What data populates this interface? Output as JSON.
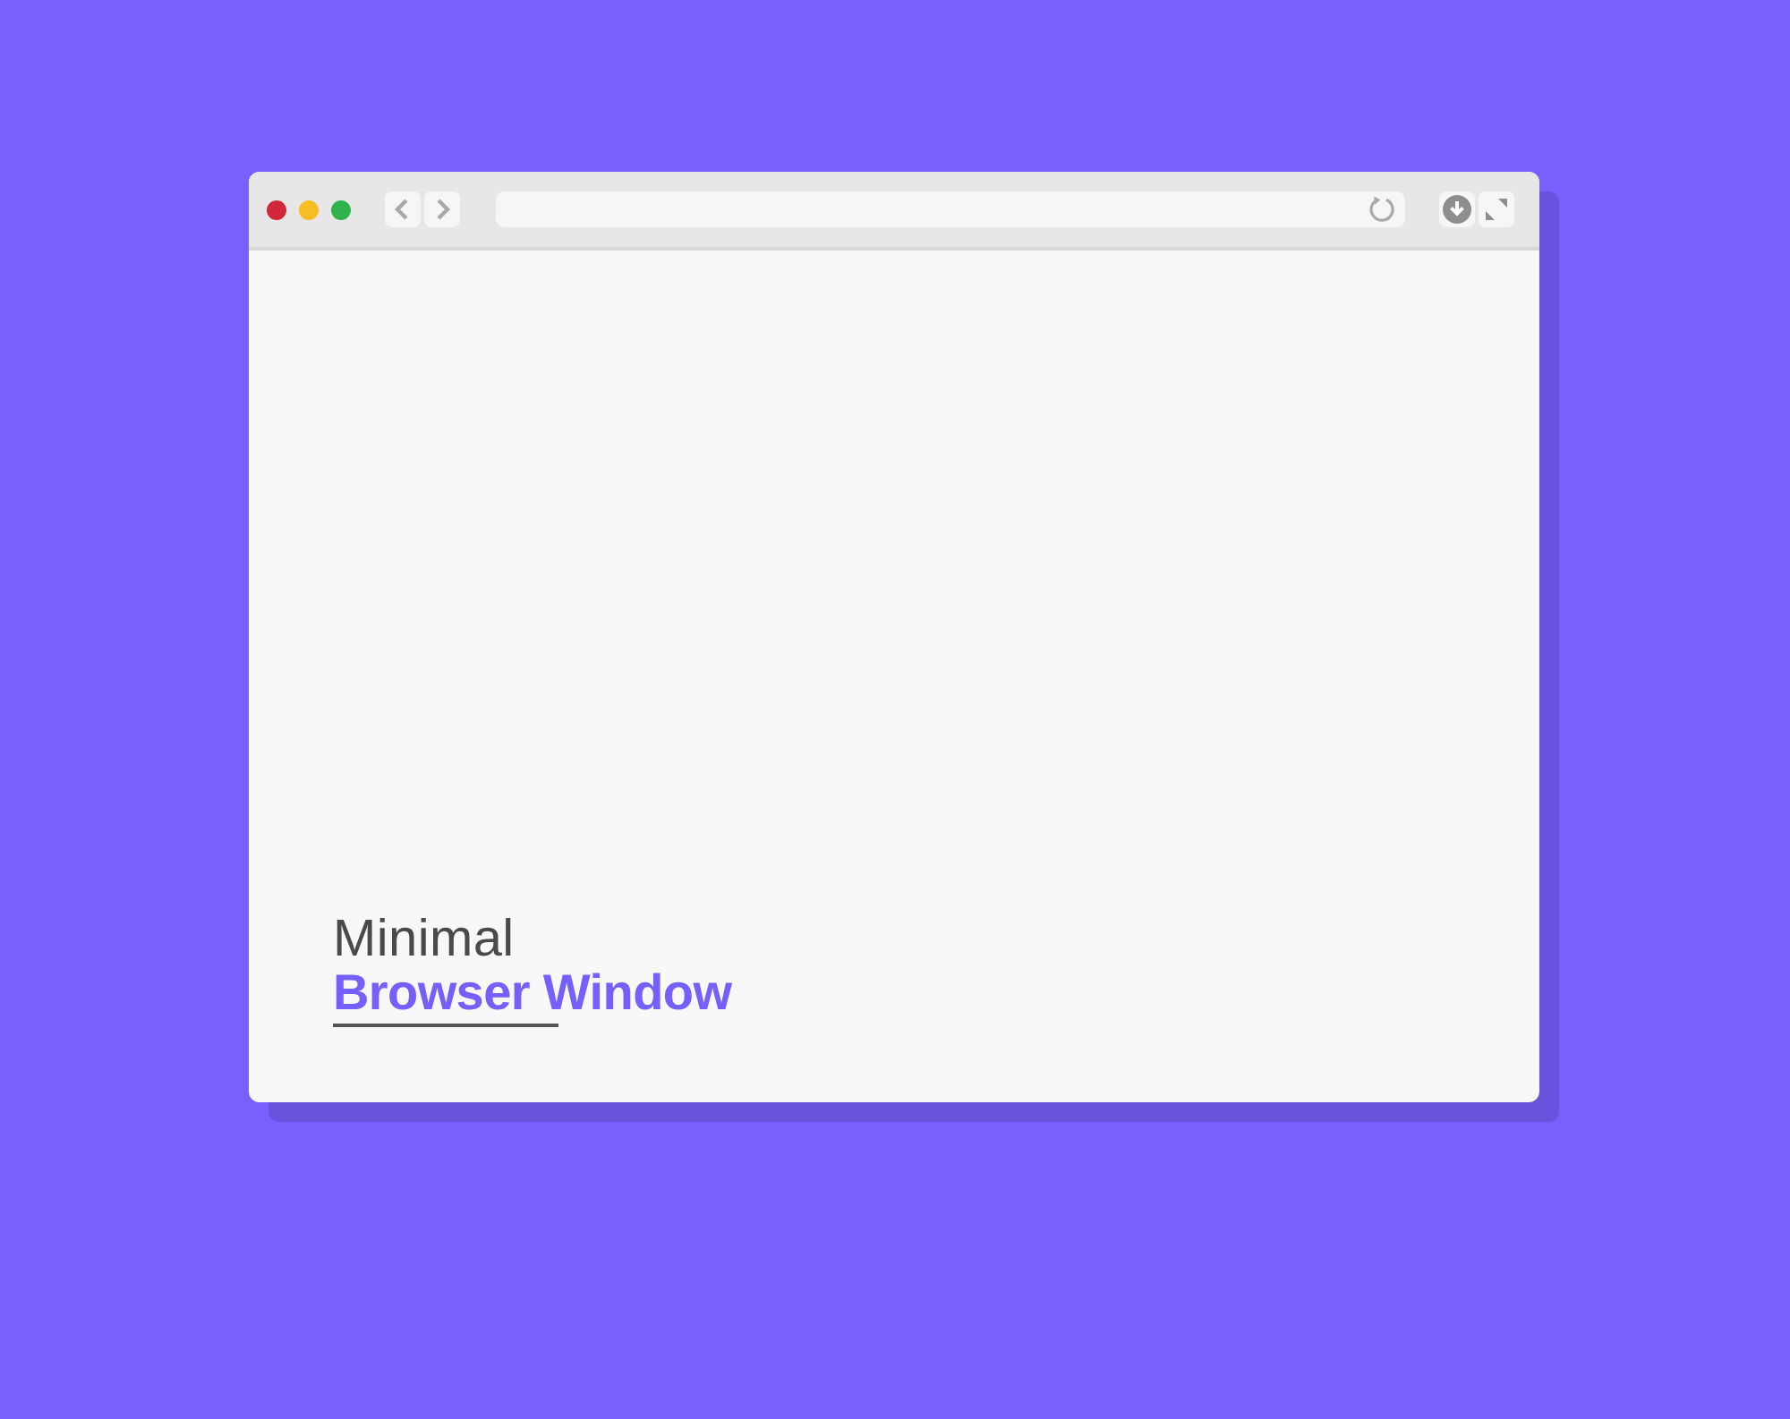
{
  "window_controls": [
    {
      "color": "#d0283a"
    },
    {
      "color": "#f8bd22"
    },
    {
      "color": "#2fb34a"
    }
  ],
  "heading": {
    "line_1": "Minimal",
    "line_2": "Browser Window"
  }
}
